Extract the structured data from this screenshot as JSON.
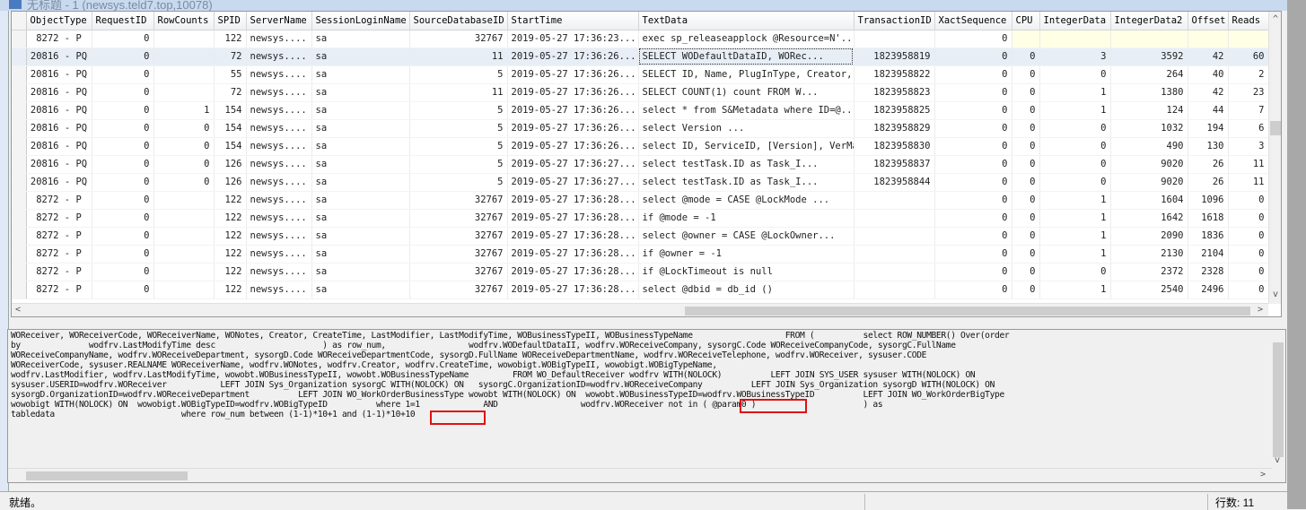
{
  "window": {
    "title": "无标题 - 1 (newsys.teld7.top,10078)"
  },
  "grid": {
    "columns": [
      "ObjectType",
      "RequestID",
      "RowCounts",
      "SPID",
      "ServerName",
      "SessionLoginName",
      "SourceDatabaseID",
      "StartTime",
      "TextData",
      "TransactionID",
      "XactSequence",
      "CPU",
      "IntegerData",
      "IntegerData2",
      "Offset",
      "Reads"
    ],
    "rows": [
      [
        "8272 - P",
        "0",
        "",
        "122",
        "newsys....",
        "sa",
        "32767",
        "2019-05-27 17:36:23...",
        "exec sp_releaseapplock @Resource=N'...",
        "",
        "0",
        "",
        "",
        "",
        "",
        ""
      ],
      [
        "20816 - PQ",
        "0",
        "",
        "72",
        "newsys....",
        "sa",
        "11",
        "2019-05-27 17:36:26...",
        "SELECT         WODefaultDataID, WORec...",
        "1823958819",
        "0",
        "0",
        "3",
        "3592",
        "42",
        "60"
      ],
      [
        "20816 - PQ",
        "0",
        "",
        "55",
        "newsys....",
        "sa",
        "5",
        "2019-05-27 17:36:26...",
        "SELECT ID, Name, PlugInType, Creator, L...",
        "1823958822",
        "0",
        "0",
        "0",
        "264",
        "40",
        "2"
      ],
      [
        "20816 - PQ",
        "0",
        "",
        "72",
        "newsys....",
        "sa",
        "11",
        "2019-05-27 17:36:26...",
        "SELECT COUNT(1) count        FROM W...",
        "1823958823",
        "0",
        "0",
        "1",
        "1380",
        "42",
        "23"
      ],
      [
        "20816 - PQ",
        "0",
        "1",
        "154",
        "newsys....",
        "sa",
        "5",
        "2019-05-27 17:36:26...",
        "select * from S&Metadata where ID=@...",
        "1823958825",
        "0",
        "0",
        "1",
        "124",
        "44",
        "7"
      ],
      [
        "20816 - PQ",
        "0",
        "0",
        "154",
        "newsys....",
        "sa",
        "5",
        "2019-05-27 17:36:26...",
        "select Version                   ...",
        "1823958829",
        "0",
        "0",
        "0",
        "1032",
        "194",
        "6"
      ],
      [
        "20816 - PQ",
        "0",
        "0",
        "154",
        "newsys....",
        "sa",
        "5",
        "2019-05-27 17:36:26...",
        "select ID, ServiceID, [Version], VerMa...",
        "1823958830",
        "0",
        "0",
        "0",
        "490",
        "130",
        "3"
      ],
      [
        "20816 - PQ",
        "0",
        "0",
        "126",
        "newsys....",
        "sa",
        "5",
        "2019-05-27 17:36:27...",
        "select        testTask.ID as Task_I...",
        "1823958837",
        "0",
        "0",
        "0",
        "9020",
        "26",
        "11"
      ],
      [
        "20816 - PQ",
        "0",
        "0",
        "126",
        "newsys....",
        "sa",
        "5",
        "2019-05-27 17:36:27...",
        "select        testTask.ID as Task_I...",
        "1823958844",
        "0",
        "0",
        "0",
        "9020",
        "26",
        "11"
      ],
      [
        "8272 - P",
        "0",
        "",
        "122",
        "newsys....",
        "sa",
        "32767",
        "2019-05-27 17:36:28...",
        "select @mode =     CASE @LockMode  ...",
        "",
        "0",
        "0",
        "1",
        "1604",
        "1096",
        "0"
      ],
      [
        "8272 - P",
        "0",
        "",
        "122",
        "newsys....",
        "sa",
        "32767",
        "2019-05-27 17:36:28...",
        "if @mode = -1",
        "",
        "0",
        "0",
        "1",
        "1642",
        "1618",
        "0"
      ],
      [
        "8272 - P",
        "0",
        "",
        "122",
        "newsys....",
        "sa",
        "32767",
        "2019-05-27 17:36:28...",
        "select @owner =     CASE @LockOwner...",
        "",
        "0",
        "0",
        "1",
        "2090",
        "1836",
        "0"
      ],
      [
        "8272 - P",
        "0",
        "",
        "122",
        "newsys....",
        "sa",
        "32767",
        "2019-05-27 17:36:28...",
        "if @owner = -1",
        "",
        "0",
        "0",
        "1",
        "2130",
        "2104",
        "0"
      ],
      [
        "8272 - P",
        "0",
        "",
        "122",
        "newsys....",
        "sa",
        "32767",
        "2019-05-27 17:36:28...",
        "if @LockTimeout is null",
        "",
        "0",
        "0",
        "0",
        "2372",
        "2328",
        "0"
      ],
      [
        "8272 - P",
        "0",
        "",
        "122",
        "newsys....",
        "sa",
        "32767",
        "2019-05-27 17:36:28...",
        "select @dbid = db_id ()",
        "",
        "0",
        "0",
        "1",
        "2540",
        "2496",
        "0"
      ]
    ],
    "selected_row": 1
  },
  "sql_text": {
    "lines": [
      "WOReceiver, WOReceiverCode, WOReceiverName, WONotes, Creator, CreateTime, LastModifier, LastModifyTime, WOBusinessTypeII, WOBusinessTypeName                   FROM (          select ROW_NUMBER() Over(order",
      "by              wodfrv.LastModifyTime desc                      ) as row_num,                 wodfrv.WODefaultDataII, wodfrv.WOReceiveCompany, sysorgC.Code WOReceiveCompanyCode, sysorgC.FullName",
      "WOReceiveCompanyName, wodfrv.WOReceiveDepartment, sysorgD.Code WOReceiveDepartmentCode, sysorgD.FullName WOReceiveDepartmentName, wodfrv.WOReceiveTelephone, wodfrv.WOReceiver, sysuser.CODE",
      "WOReceiverCode, sysuser.REALNAME WOReceiverName, wodfrv.WONotes, wodfrv.Creator, wodfrv.CreateTime, wowobigt.WOBigTypeII, wowobigt.WOBigTypeName,",
      "wodfrv.LastModifier, wodfrv.LastModifyTime, wowobt.WOBusinessTypeII, wowobt.WOBusinessTypeName         FROM WO_DefaultReceiver wodfrv WITH(NOLOCK)          LEFT JOIN SYS_USER sysuser WITH(NOLOCK) ON",
      "sysuser.USERID=wodfrv.WOReceiver           LEFT JOIN Sys_Organization sysorgC WITH(NOLOCK) ON   sysorgC.OrganizationID=wodfrv.WOReceiveCompany          LEFT JOIN Sys_Organization sysorgD WITH(NOLOCK) ON",
      "sysorgD.OrganizationID=wodfrv.WOReceiveDepartment          LEFT JOIN WO_WorkOrderBusinessType wowobt WITH(NOLOCK) ON  wowobt.WOBusinessTypeID=wodfrv.WOBusinessTypeID          LEFT JOIN WO_WorkOrderBigType",
      "wowobigt WITH(NOLOCK) ON  wowobigt.WOBigTypeID=wodfrv.WOBigTypeID          where 1=1             AND                 wodfrv.WOReceiver not in ( @param0 )                      ) as",
      "tabledata                          where row_num between (1-1)*10+1 and (1-1)*10+10"
    ]
  },
  "status": {
    "text": "就绪。",
    "row_count": "行数: 11"
  },
  "colors": {
    "highlight_box": "#e01010",
    "selected_row": "#e7eef6",
    "keyword": "#2a3fc0"
  }
}
